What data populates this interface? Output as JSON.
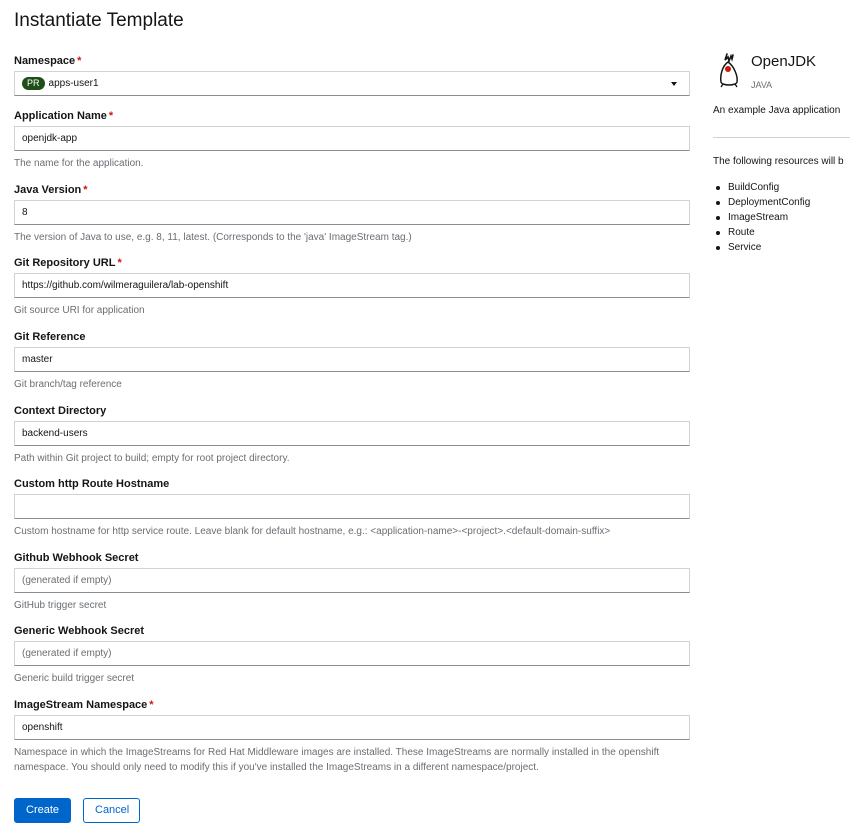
{
  "page": {
    "title": "Instantiate Template"
  },
  "form": {
    "namespace": {
      "label": "Namespace",
      "badge": "PR",
      "value": "apps-user1"
    },
    "fields": [
      {
        "label": "Application Name",
        "required": "*",
        "value": "openjdk-app",
        "placeholder": "",
        "helper": "The name for the application."
      },
      {
        "label": "Java Version",
        "required": "*",
        "value": "8",
        "placeholder": "",
        "helper": "The version of Java to use, e.g. 8, 11, latest. (Corresponds to the 'java' ImageStream tag.)"
      },
      {
        "label": "Git Repository URL",
        "required": "*",
        "value": "https://github.com/wilmeraguilera/lab-openshift",
        "placeholder": "",
        "helper": "Git source URI for application"
      },
      {
        "label": "Git Reference",
        "required": "",
        "value": "master",
        "placeholder": "",
        "helper": "Git branch/tag reference"
      },
      {
        "label": "Context Directory",
        "required": "",
        "value": "backend-users",
        "placeholder": "",
        "helper": "Path within Git project to build; empty for root project directory."
      },
      {
        "label": "Custom http Route Hostname",
        "required": "",
        "value": "",
        "placeholder": "",
        "helper": "Custom hostname for http service route. Leave blank for default hostname, e.g.: <application-name>-<project>.<default-domain-suffix>"
      },
      {
        "label": "Github Webhook Secret",
        "required": "",
        "value": "",
        "placeholder": "(generated if empty)",
        "helper": "GitHub trigger secret"
      },
      {
        "label": "Generic Webhook Secret",
        "required": "",
        "value": "",
        "placeholder": "(generated if empty)",
        "helper": "Generic build trigger secret"
      },
      {
        "label": "ImageStream Namespace",
        "required": "*",
        "value": "openshift",
        "placeholder": "",
        "helper": "Namespace in which the ImageStreams for Red Hat Middleware images are installed. These ImageStreams are normally installed in the openshift namespace. You should only need to modify this if you've installed the ImageStreams in a different namespace/project."
      }
    ],
    "required_mark": "*"
  },
  "actions": {
    "create": "Create",
    "cancel": "Cancel"
  },
  "sidebar": {
    "title": "OpenJDK",
    "subtitle": "JAVA",
    "description": "An example Java application",
    "resources_intro": "The following resources will b",
    "resources": [
      "BuildConfig",
      "DeploymentConfig",
      "ImageStream",
      "Route",
      "Service"
    ],
    "logo_icon": "java-duke-icon"
  },
  "colors": {
    "primary": "#0066cc",
    "required": "#c9190b",
    "badge": "#1e4f18",
    "helper": "#6a6e73"
  }
}
